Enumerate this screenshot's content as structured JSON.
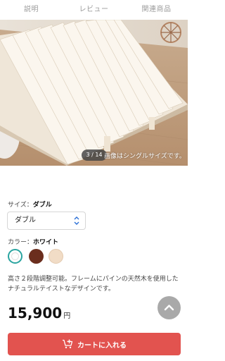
{
  "tabs": [
    "説明",
    "レビュー",
    "関連商品"
  ],
  "gallery": {
    "counter": "3 / 14",
    "caption": "画像はシングルサイズです。"
  },
  "size": {
    "label": "サイズ：",
    "selected_name": "ダブル",
    "select_value": "ダブル"
  },
  "color": {
    "label": "カラー：",
    "selected_name": "ホワイト",
    "swatches": [
      {
        "name": "white",
        "hex": "#ffffff"
      },
      {
        "name": "brown",
        "hex": "#6b2e1e"
      },
      {
        "name": "natural",
        "hex": "#f1dcc6"
      }
    ],
    "selected_index": 0
  },
  "description": "高さ２段階調整可能。フレームにパインの天然木を使用したナチュラルテイストなデザインです。",
  "price": {
    "amount": "15,900",
    "unit": "円"
  },
  "cart_button": {
    "label": "カートに入れる",
    "color": "#e2534f",
    "icon": "cart-plus-icon"
  },
  "scroll_top_icon": "chevron-up-icon"
}
